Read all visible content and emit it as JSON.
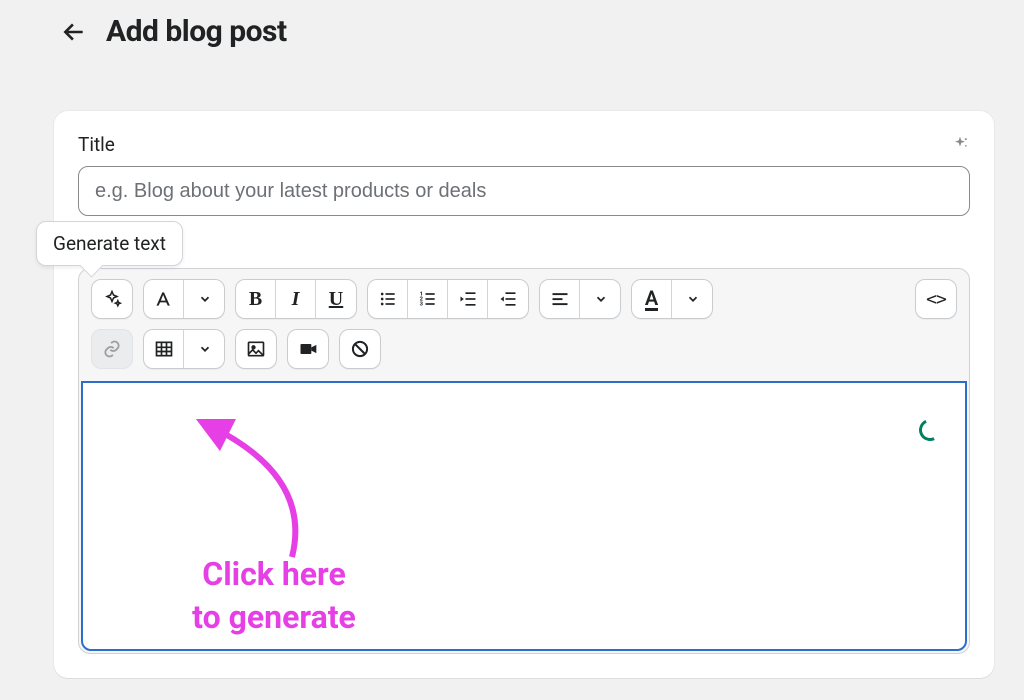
{
  "header": {
    "title": "Add blog post"
  },
  "form": {
    "title_label": "Title",
    "title_placeholder": "e.g. Blog about your latest products or deals"
  },
  "tooltip": {
    "generate_text": "Generate text"
  },
  "toolbar": {
    "source_label": "<>"
  },
  "annotation": {
    "line1": "Click here",
    "line2": "to generate"
  },
  "colors": {
    "annotation": "#e63fe6",
    "focus": "#2c6ecb",
    "spinner": "#008060"
  }
}
